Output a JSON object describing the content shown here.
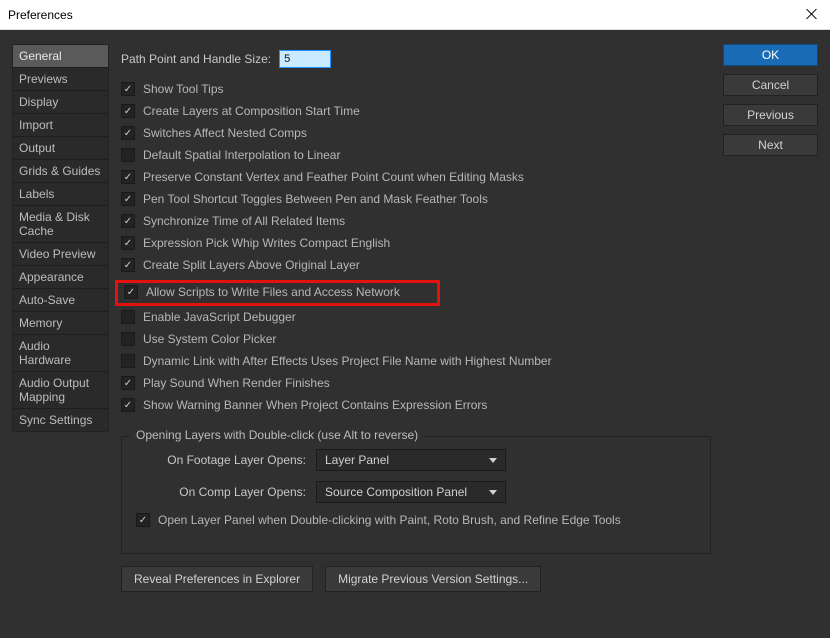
{
  "window": {
    "title": "Preferences"
  },
  "sidebar": {
    "items": [
      "General",
      "Previews",
      "Display",
      "Import",
      "Output",
      "Grids & Guides",
      "Labels",
      "Media & Disk Cache",
      "Video Preview",
      "Appearance",
      "Auto-Save",
      "Memory",
      "Audio Hardware",
      "Audio Output Mapping",
      "Sync Settings"
    ],
    "activeIndex": 0
  },
  "field": {
    "path_point_label": "Path Point and Handle Size:",
    "path_point_value": "5"
  },
  "checks": [
    {
      "label": "Show Tool Tips",
      "checked": true
    },
    {
      "label": "Create Layers at Composition Start Time",
      "checked": true
    },
    {
      "label": "Switches Affect Nested Comps",
      "checked": true
    },
    {
      "label": "Default Spatial Interpolation to Linear",
      "checked": false
    },
    {
      "label": "Preserve Constant Vertex and Feather Point Count when Editing Masks",
      "checked": true
    },
    {
      "label": "Pen Tool Shortcut Toggles Between Pen and Mask Feather Tools",
      "checked": true
    },
    {
      "label": "Synchronize Time of All Related Items",
      "checked": true
    },
    {
      "label": "Expression Pick Whip Writes Compact English",
      "checked": true
    },
    {
      "label": "Create Split Layers Above Original Layer",
      "checked": true
    },
    {
      "label": "Allow Scripts to Write Files and Access Network",
      "checked": true,
      "highlight": true
    },
    {
      "label": "Enable JavaScript Debugger",
      "checked": false
    },
    {
      "label": "Use System Color Picker",
      "checked": false
    },
    {
      "label": "Dynamic Link with After Effects Uses Project File Name with Highest Number",
      "checked": false
    },
    {
      "label": "Play Sound When Render Finishes",
      "checked": true
    },
    {
      "label": "Show Warning Banner When Project Contains Expression Errors",
      "checked": true
    }
  ],
  "group": {
    "title": "Opening Layers with Double-click (use Alt to reverse)",
    "footage_label": "On Footage Layer Opens:",
    "footage_value": "Layer Panel",
    "comp_label": "On Comp Layer Opens:",
    "comp_value": "Source Composition Panel",
    "open_panel_check": {
      "label": "Open Layer Panel when Double-clicking with Paint, Roto Brush, and Refine Edge Tools",
      "checked": true
    }
  },
  "bottom": {
    "reveal": "Reveal Preferences in Explorer",
    "migrate": "Migrate Previous Version Settings..."
  },
  "buttons": {
    "ok": "OK",
    "cancel": "Cancel",
    "previous": "Previous",
    "next": "Next"
  }
}
